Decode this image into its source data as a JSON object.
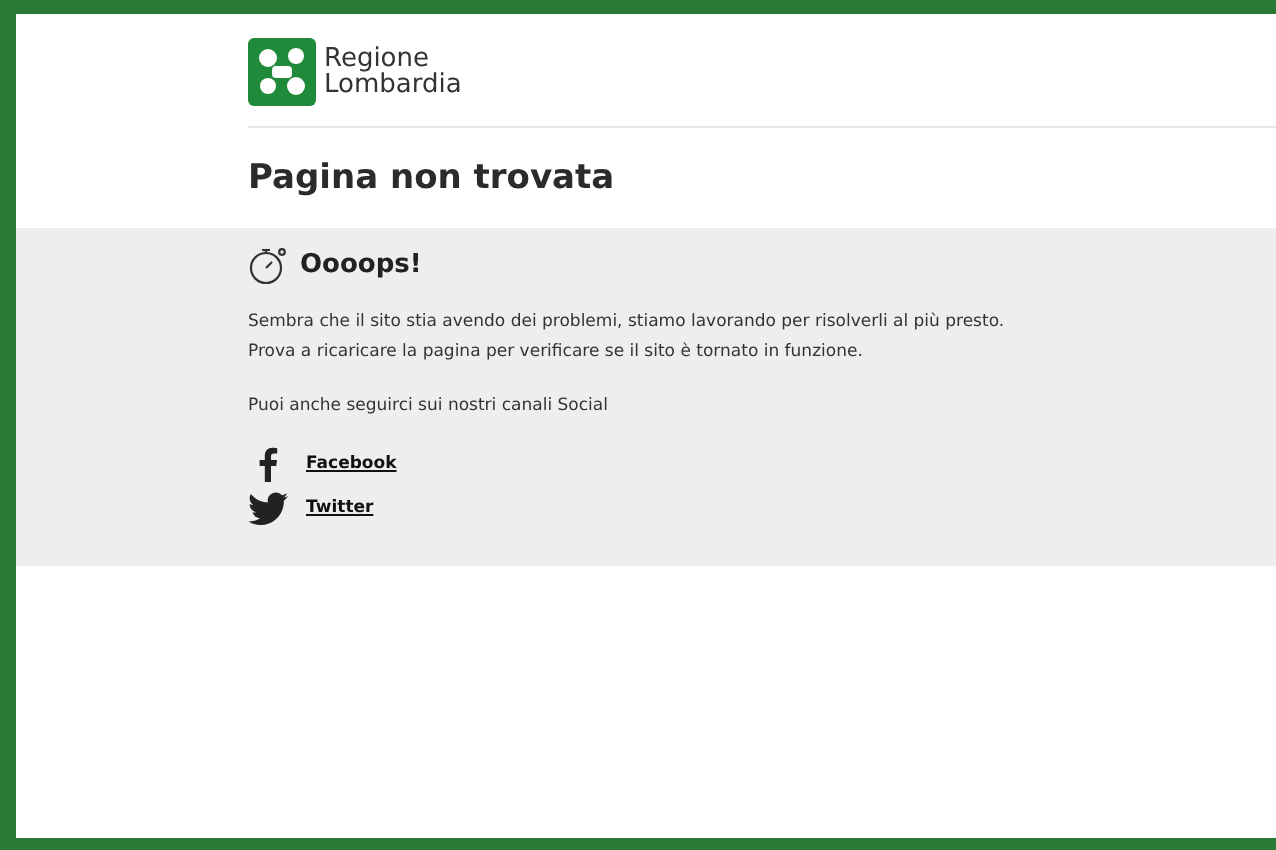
{
  "logo": {
    "line_1": "Regione",
    "line_2": "Lombardia"
  },
  "page_title": "Pagina non trovata",
  "notice": {
    "heading": "Oooops!",
    "paragraphs": [
      "Sembra che il sito stia avendo dei problemi, stiamo lavorando per risolverli al più presto.\nProva a ricaricare la pagina per verificare se il sito è tornato in funzione.",
      "Puoi anche seguirci sui nostri canali Social"
    ],
    "social_links": [
      {
        "kind": "facebook",
        "label": "Facebook"
      },
      {
        "kind": "twitter",
        "label": "Twitter"
      }
    ]
  }
}
